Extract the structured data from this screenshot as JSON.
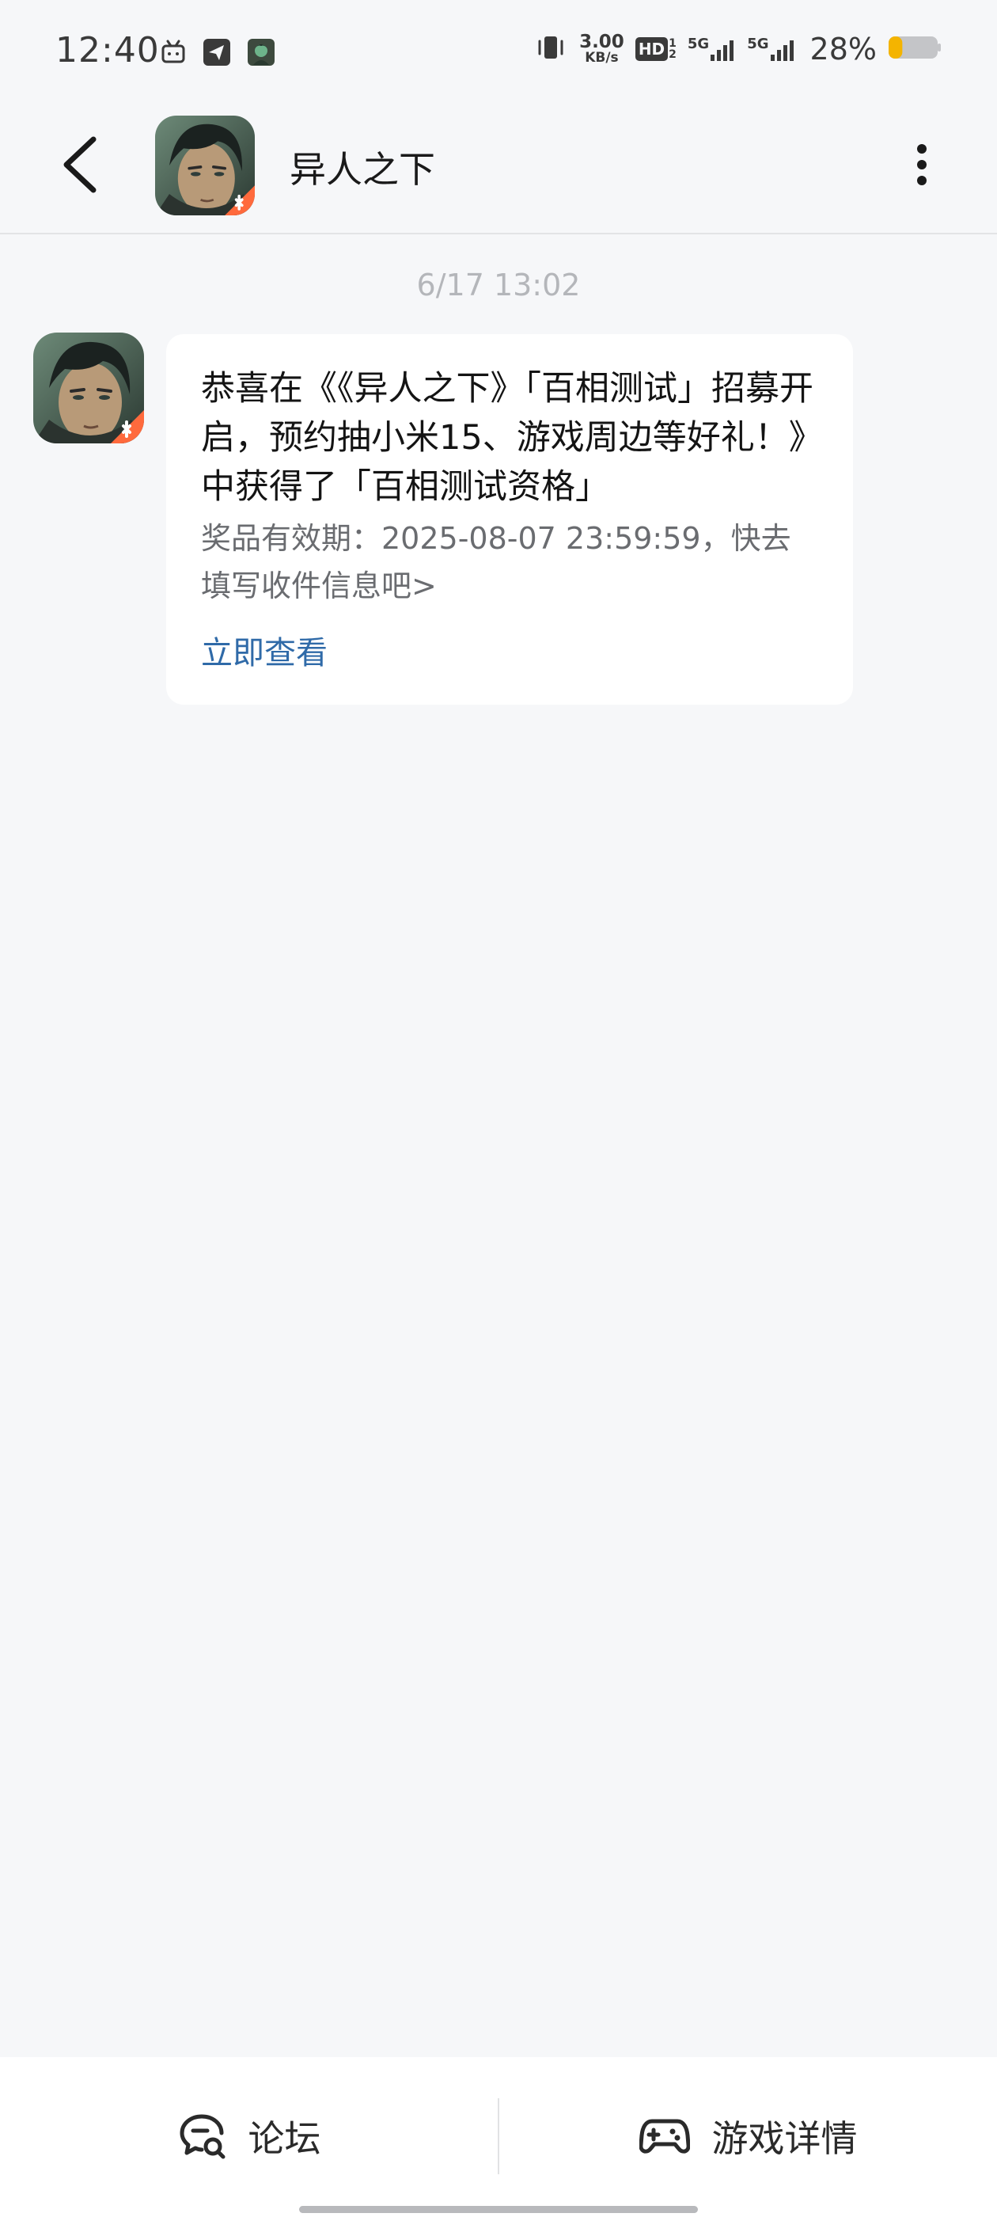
{
  "status_bar": {
    "time": "12:40",
    "net_speed_value": "3.00",
    "net_speed_unit": "KB/s",
    "hd_label": "HD",
    "sim1_label": "5G",
    "sim2_label": "5G",
    "battery_percent": "28%",
    "battery_level": 0.28,
    "battery_color": "#f4b400"
  },
  "header": {
    "title": "异人之下"
  },
  "conversation": {
    "timestamp": "6/17  13:02",
    "message": {
      "title": "恭喜在《《异人之下》「百相测试」招募开启，预约抽小米15、游戏周边等好礼！》中获得了「百相测试资格」",
      "description": "奖品有效期：2025-08-07 23:59:59，快去填写收件信息吧>",
      "link_label": "立即查看"
    }
  },
  "bottom_bar": {
    "forum_label": "论坛",
    "game_details_label": "游戏详情"
  },
  "colors": {
    "link": "#2f6aa8",
    "background": "#f6f7f9",
    "badge_orange": "#ff6a3d"
  },
  "icons": {
    "back": "back-arrow-icon",
    "more": "more-vertical-icon",
    "forum": "forum-chat-icon",
    "game": "gamepad-icon"
  }
}
